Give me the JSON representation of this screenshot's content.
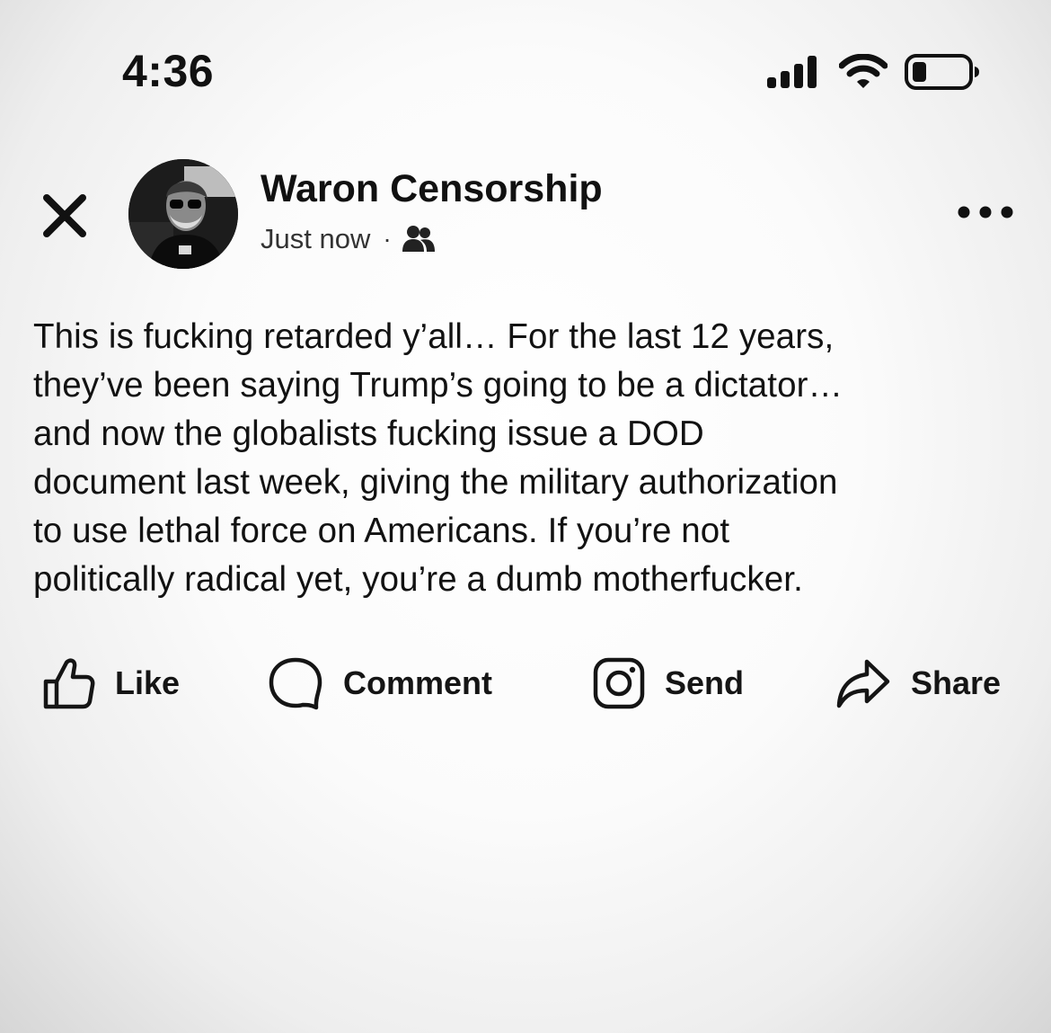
{
  "status_bar": {
    "time": "4:36",
    "icons": [
      "cellular-signal-icon",
      "wifi-icon",
      "battery-low-icon"
    ]
  },
  "post": {
    "author": "Waron Censorship",
    "timestamp": "Just now",
    "separator": "·",
    "audience_icon": "friends-icon",
    "body_lines": [
      "This is fucking retarded y’all… For the last 12 years,",
      "they’ve been saying Trump’s going to be a dictator…",
      "and now the globalists fucking issue a DOD",
      "document last week, giving the military authorization",
      "to use lethal force on Americans. If you’re not",
      "politically radical yet, you’re a dumb motherfucker."
    ]
  },
  "actions": {
    "like": "Like",
    "comment": "Comment",
    "send": "Send",
    "share": "Share"
  },
  "colors": {
    "text": "#111111",
    "background": "#ffffff",
    "vignette": "#d6d6d6"
  }
}
